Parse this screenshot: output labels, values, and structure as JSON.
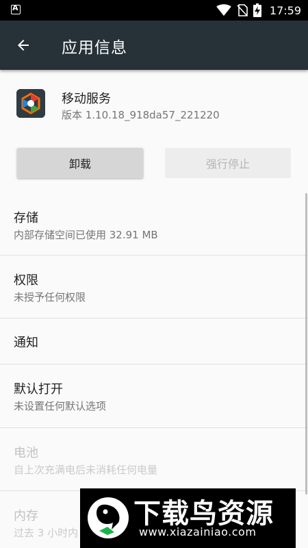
{
  "status_bar": {
    "time": "17:59",
    "icons": [
      "app-notification-icon",
      "wifi-icon",
      "no-sim-icon",
      "battery-charging-icon"
    ]
  },
  "app_bar": {
    "title": "应用信息"
  },
  "app": {
    "name": "移动服务",
    "version": "版本 1.10.18_918da57_221220"
  },
  "buttons": {
    "uninstall": "卸载",
    "force_stop": "强行停止"
  },
  "settings": [
    {
      "title": "存储",
      "summary": "内部存储空间已使用 32.91 MB",
      "enabled": true
    },
    {
      "title": "权限",
      "summary": "未授予任何权限",
      "enabled": true
    },
    {
      "title": "通知",
      "summary": "",
      "enabled": true
    },
    {
      "title": "默认打开",
      "summary": "未设置任何默认选项",
      "enabled": true
    },
    {
      "title": "电池",
      "summary": "自上次充满电后未消耗任何电量",
      "enabled": false
    },
    {
      "title": "内存",
      "summary": "过去 3 小时内",
      "enabled": false
    }
  ],
  "watermark": {
    "title": "下载鸟资源",
    "url": "www.xiazainiao.com"
  },
  "colors": {
    "app_bar": "#263238",
    "background": "#fafafa",
    "status_bar": "#000000"
  }
}
